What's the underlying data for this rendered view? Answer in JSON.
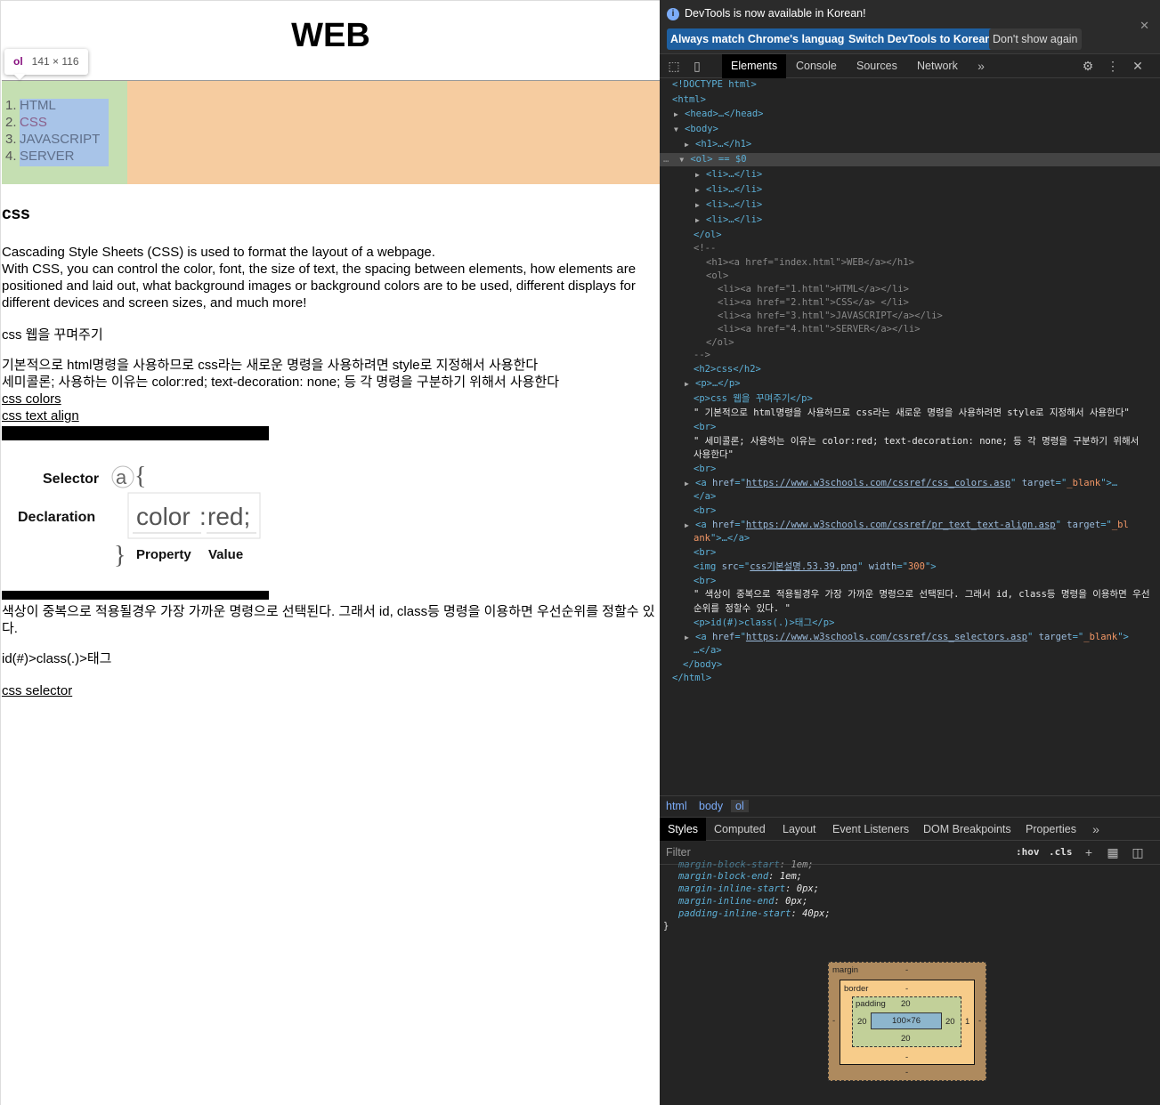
{
  "page": {
    "title": "WEB",
    "tooltip": {
      "tag": "ol",
      "dims": "141 × 116"
    },
    "nav": [
      {
        "num": "1.",
        "label": "HTML"
      },
      {
        "num": "2.",
        "label": "CSS"
      },
      {
        "num": "3.",
        "label": "JAVASCRIPT"
      },
      {
        "num": "4.",
        "label": "SERVER"
      }
    ],
    "h2": "css",
    "p1_lines": [
      "Cascading Style Sheets (CSS) is used to format the layout of a webpage.",
      "With CSS, you can control the color, font, the size of text, the spacing between elements, how elements are",
      "positioned and laid out, what background images or background colors are to be used, different displays for",
      "different devices and screen sizes, and much more!"
    ],
    "p2": "css 웹을 꾸며주기",
    "p3_lines": [
      "기본적으로 html명령을 사용하므로 css라는 새로운 명령을 사용하려면 style로 지정해서 사용한다",
      "세미콜론; 사용하는 이유는 color:red; text-decoration: none; 등 각 명령을 구분하기 위해서 사용한다"
    ],
    "link_colors": "css colors",
    "link_align": "css text align",
    "image": {
      "selector_label": "Selector",
      "declaration_label": "Declaration",
      "selector_char": "a",
      "brace_open": "{",
      "brace_close": "}",
      "prop": "color",
      "colon": ":",
      "val": "red;",
      "property_label": "Property",
      "value_label": "Value"
    },
    "p4_lines": [
      "색상이 중복으로 적용될경우 가장 가까운 명령으로 선택된다. 그래서 id, class등 명령을 이용하면 우선순위를 정할수 있",
      "다."
    ],
    "p5": "id(#)>class(.)>태그",
    "link_selector": "css selector"
  },
  "devtools": {
    "notice": "DevTools is now available in Korean!",
    "btn_match": "Always match Chrome's language",
    "btn_switch": "Switch DevTools to Korean",
    "btn_dont": "Don't show again",
    "tabs": [
      "Elements",
      "Console",
      "Sources",
      "Network"
    ],
    "dom_lines": [
      "<!DOCTYPE html>",
      "<html>",
      "<head>…</head>",
      "<body>",
      "<h1>…</h1>",
      "<ol> == $0",
      "<li>…</li>",
      "<li>…</li>",
      "<li>…</li>",
      "<li>…</li>",
      "</ol>",
      "<!--",
      "<h1><a href=\"index.html\">WEB</a></h1>",
      "<ol>",
      "<li><a href=\"1.html\">HTML</a></li>",
      "<li><a href=\"2.html\">CSS</a> </li>",
      "<li><a href=\"3.html\">JAVASCRIPT</a></li>",
      "<li><a href=\"4.html\">SERVER</a></li>",
      "</ol>",
      "-->",
      "<h2>css</h2>",
      "<p>…</p>",
      "<p>css 웹을 꾸며주기</p>",
      "\" 기본적으로 html명령을 사용하므로 css라는 새로운 명령을 사용하려면 style로 지정해서 사용한다\"",
      "<br>",
      "\" 세미콜론; 사용하는 이유는 color:red; text-decoration: none; 등 각 명령을 구분하기 위해서",
      "사용한다\"",
      "<br>",
      "https://www.w3schools.com/cssref/css_colors.asp",
      "</a>",
      "<br>",
      "https://www.w3schools.com/cssref/pr_text_text-align.asp",
      "ank\">…</a>",
      "<br>",
      "css기본설명.53.39.png",
      "<br>",
      "\" 색상이 중복으로 적용될경우 가장 가까운 명령으로 선택된다. 그래서 id, class등 명령을 이용하면 우선",
      "순위를 정할수 있다. \"",
      "<p>id(#)>class(.)>태그</p>",
      "https://www.w3schools.com/cssref/css_selectors.asp",
      "…</a>",
      "</body>",
      "</html>"
    ],
    "breadcrumbs": [
      "html",
      "body",
      "ol"
    ],
    "style_tabs": [
      "Styles",
      "Computed",
      "Layout",
      "Event Listeners",
      "DOM Breakpoints",
      "Properties"
    ],
    "filter_placeholder": "Filter",
    "hov": ":hov",
    "cls": ".cls",
    "css_rules": [
      {
        "prop": "margin-block-start",
        "val": "1em;"
      },
      {
        "prop": "margin-block-end",
        "val": "1em;"
      },
      {
        "prop": "margin-inline-start",
        "val": "0px;"
      },
      {
        "prop": "margin-inline-end",
        "val": "0px;"
      },
      {
        "prop": "padding-inline-start",
        "val": "40px;"
      }
    ],
    "close_brace": "}",
    "box_model": {
      "margin_label": "margin",
      "margin_val": "-",
      "border_label": "border",
      "border_val": "-",
      "padding_label": "padding",
      "padding_top": "20",
      "padding_bottom": "20",
      "padding_left": "20",
      "padding_right": "20",
      "content": "100×76",
      "border_right": "1"
    }
  }
}
